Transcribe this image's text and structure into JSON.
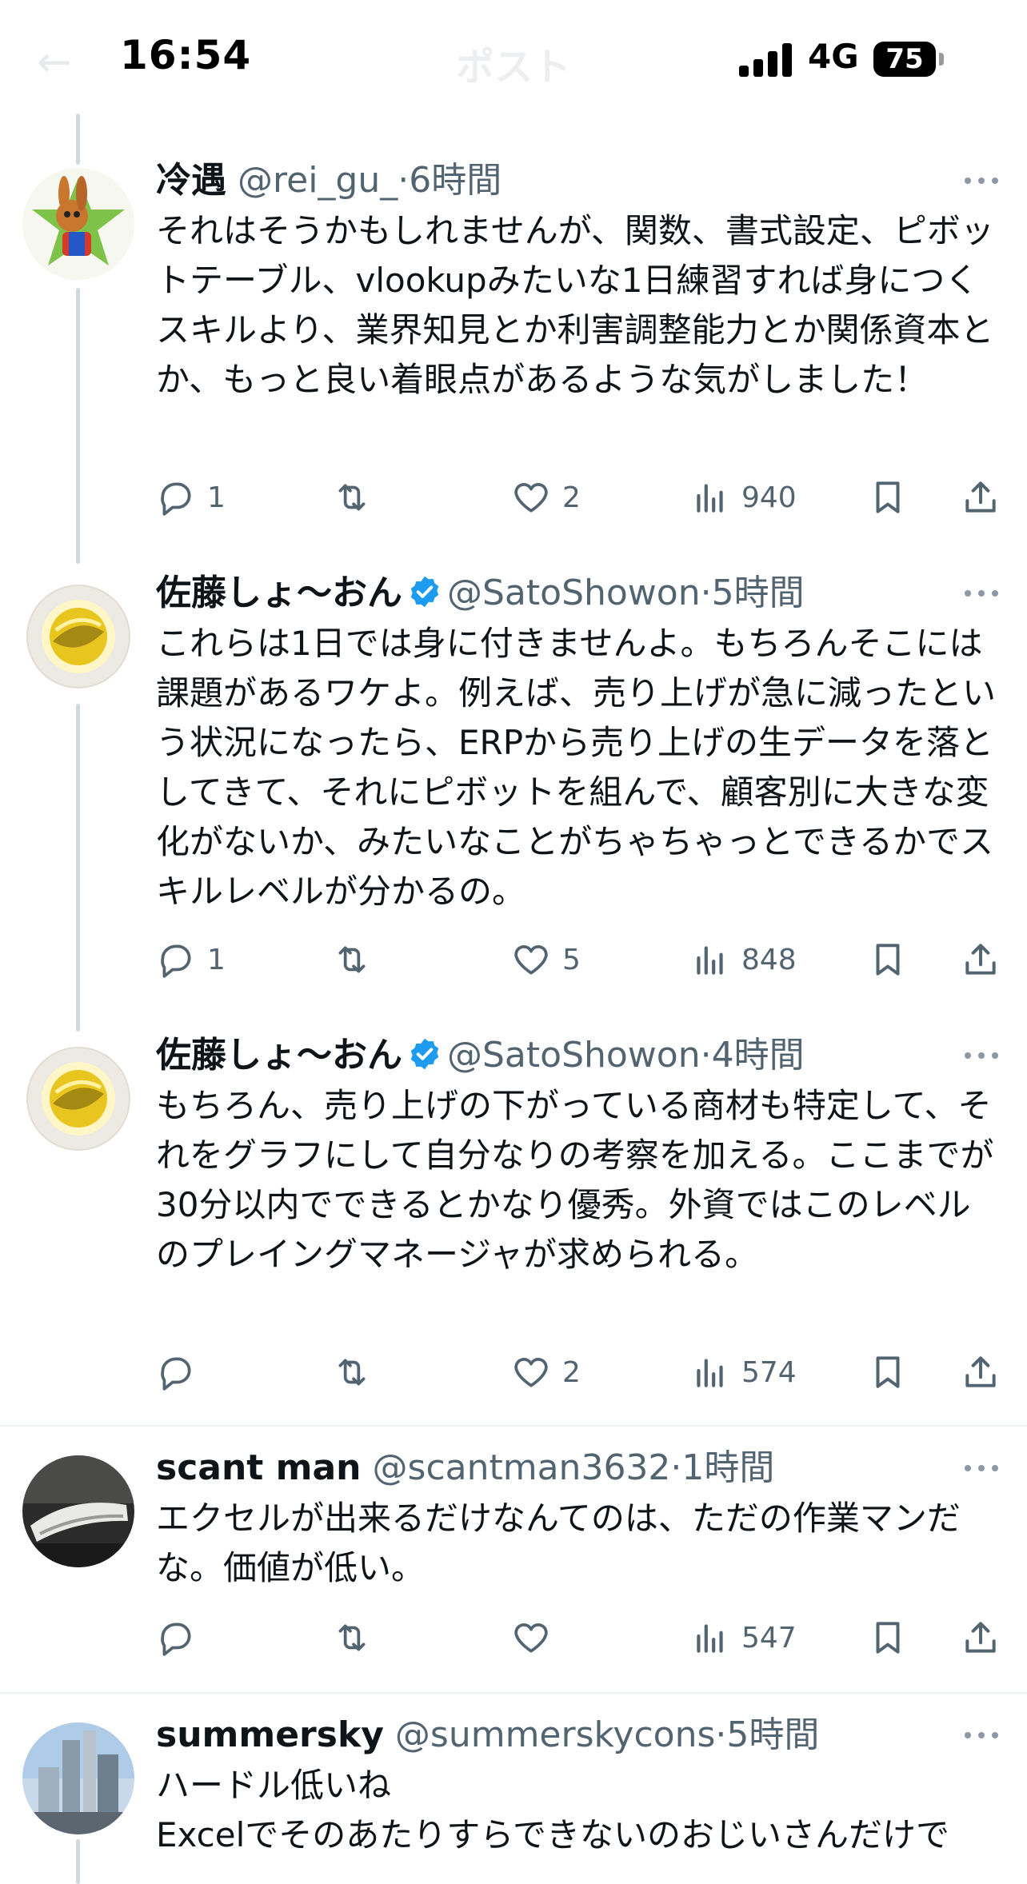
{
  "status": {
    "time": "16:54",
    "network": "4G",
    "battery": "75",
    "ghost_title": "ポスト"
  },
  "tweets": [
    {
      "name": "冷遇",
      "handle": "@rei_gu_",
      "time": "6時間",
      "verified": false,
      "text": "それはそうかもしれませんが、関数、書式設定、ピボットテーブル、vlookupみたいな1日練習すれば身につくスキルより、業界知見とか利害調整能力とか関係資本とか、もっと良い着眼点があるような気がしました！",
      "replies": "1",
      "retweets": "",
      "likes": "2",
      "views": "940"
    },
    {
      "name": "佐藤しょ〜おん",
      "handle": "@SatoShowon",
      "time": "5時間",
      "verified": true,
      "text": "これらは1日では身に付きませんよ。もちろんそこには課題があるワケよ。例えば、売り上げが急に減ったという状況になったら、ERPから売り上げの生データを落としてきて、それにピボットを組んで、顧客別に大きな変化がないか、みたいなことがちゃちゃっとできるかでスキルレベルが分かるの。",
      "replies": "1",
      "retweets": "",
      "likes": "5",
      "views": "848"
    },
    {
      "name": "佐藤しょ〜おん",
      "handle": "@SatoShowon",
      "time": "4時間",
      "verified": true,
      "text": "もちろん、売り上げの下がっている商材も特定して、それをグラフにして自分なりの考察を加える。ここまでが30分以内でできるとかなり優秀。外資ではこのレベルのプレイングマネージャが求められる。",
      "replies": "",
      "retweets": "",
      "likes": "2",
      "views": "574"
    },
    {
      "name": "scant man",
      "handle": "@scantman3632",
      "time": "1時間",
      "verified": false,
      "text": "エクセルが出来るだけなんてのは、ただの作業マンだな。価値が低い。",
      "replies": "",
      "retweets": "",
      "likes": "",
      "views": "547"
    },
    {
      "name": "summersky",
      "handle": "@summerskycons",
      "time": "5時間",
      "verified": false,
      "text": "ハードル低いね\nExcelでそのあたりすらできないのおじいさんだけで",
      "replies": "",
      "retweets": "",
      "likes": "",
      "views": ""
    }
  ],
  "colors": {
    "text": "#0f1419",
    "secondary": "#536471",
    "verified": "#1d9bf0",
    "thread_line": "#cfd9de",
    "divider": "#eff3f4"
  },
  "icons": [
    "reply-icon",
    "retweet-icon",
    "like-icon",
    "views-icon",
    "bookmark-icon",
    "share-icon",
    "more-icon",
    "verified-badge-icon"
  ]
}
